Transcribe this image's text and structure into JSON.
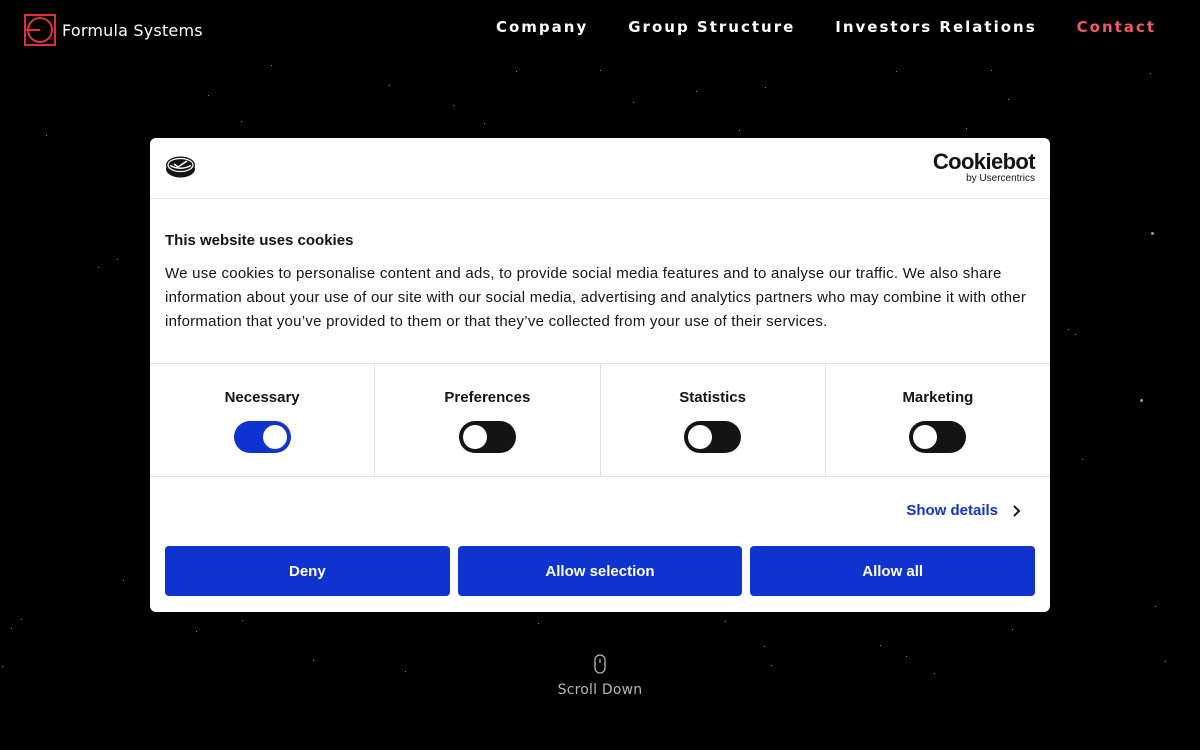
{
  "site": {
    "logo_text": "Formula Systems",
    "logo_icon": "formula-systems-logo-icon",
    "accent_color": "#ef5b67"
  },
  "nav": {
    "items": [
      {
        "label": "Company"
      },
      {
        "label": "Group Structure"
      },
      {
        "label": "Investors Relations"
      },
      {
        "label": "Contact"
      }
    ]
  },
  "cookie_dialog": {
    "brand_main": "Cookiebot",
    "brand_sub": "by Usercentrics",
    "title": "This website uses cookies",
    "text": "We use cookies to personalise content and ads, to provide social media features and to analyse our traffic. We also share information about your use of our site with our social media, advertising and analytics partners who may combine it with other information that you’ve provided to them or that they’ve collected from your use of their services.",
    "categories": [
      {
        "label": "Necessary",
        "enabled": true
      },
      {
        "label": "Preferences",
        "enabled": false
      },
      {
        "label": "Statistics",
        "enabled": false
      },
      {
        "label": "Marketing",
        "enabled": false
      }
    ],
    "show_details_label": "Show details",
    "buttons": {
      "deny": "Deny",
      "allow_selection": "Allow selection",
      "allow_all": "Allow all"
    },
    "button_color": "#1032cf"
  },
  "scroll": {
    "label": "Scroll Down",
    "icon": "mouse-icon"
  }
}
